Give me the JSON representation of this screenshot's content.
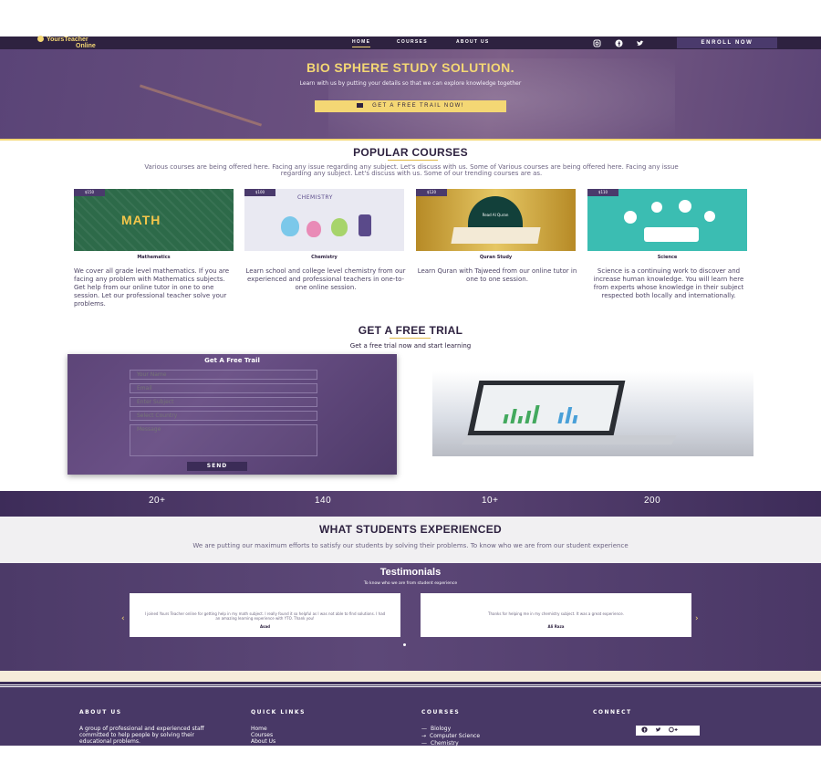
{
  "brand": {
    "line1": "YoursTeacher",
    "line2": "Online"
  },
  "nav": {
    "items": [
      "HOME",
      "COURSES",
      "ABOUT US"
    ],
    "enroll": "ENROLL NOW"
  },
  "social_icons": [
    "instagram-icon",
    "facebook-icon",
    "twitter-icon"
  ],
  "hero": {
    "title": "BIO SPHERE STUDY SOLUTION.",
    "subtitle": "Learn with us by putting your details so that we can explore knowledge together",
    "button": "GET A FREE TRAIL NOW!"
  },
  "popular": {
    "title": "POPULAR COURSES",
    "description": "Various courses are being offered here. Facing any issue regarding any subject. Let's discuss with us. Some of Various courses are being offered here. Facing any issue regarding any subject. Let's discuss with us. Some of our trending courses are as.",
    "courses": [
      {
        "price": "$150",
        "image_label": "MATH",
        "name": "Mathematics",
        "desc": "We cover all grade level mathematics. If you are facing any problem with Mathematics subjects. Get help from our online tutor in one to one session. Let our professional teacher solve your problems."
      },
      {
        "price": "$100",
        "image_label": "CHEMISTRY",
        "name": "Chemistry",
        "desc": "Learn school and college level chemistry from our experienced and professional teachers in one-to-one online session."
      },
      {
        "price": "$120",
        "image_label": "Read Al Quran",
        "name": "Quran Study",
        "desc": "Learn Quran with Tajweed from our online tutor in one to one session."
      },
      {
        "price": "$110",
        "image_label": "",
        "name": "Science",
        "desc": "Science is a continuing work to discover and increase human knowledge. You will learn here from experts whose knowledge in their subject respected both locally and internationally."
      }
    ]
  },
  "trial": {
    "title": "GET A FREE TRIAL",
    "subtitle": "Get a free trial now and start learning",
    "form_title": "Get A Free Trail",
    "fields": [
      "Your Name",
      "Email",
      "Enter Subject",
      "Select Country",
      "Message"
    ],
    "send": "SEND"
  },
  "stats": [
    "20+",
    "140",
    "10+",
    "200"
  ],
  "experience": {
    "title": "WHAT STUDENTS EXPERIENCED",
    "description": "We are putting our maximum efforts to satisfy our students by solving their problems. To know who we are from our student experience"
  },
  "testimonials": {
    "title": "Testimonials",
    "subtitle": "To know who we are from student experience",
    "prev": "‹",
    "next": "›",
    "items": [
      {
        "quote": "I joined Yours Teacher online for getting help in my math subject. I really found it so helpful as I was not able to find solutions. I had an amazing learning experience with YTO. Thank you!",
        "author": "Asad"
      },
      {
        "quote": "Thanks for helping me in my chemistry subject. It was a great experience.",
        "author": "Ali Raza"
      }
    ]
  },
  "footer": {
    "about_head": "ABOUT US",
    "about_text": "A group of professional and experienced staff committed to help people by solving their educational problems.",
    "links_head": "QUICK LINKS",
    "links": [
      "Home",
      "Courses",
      "About Us"
    ],
    "courses_head": "COURSES",
    "courses": [
      "Biology",
      "Computer Science",
      "Chemistry"
    ],
    "connect_head": "CONNECT",
    "connect_icons": [
      "facebook-icon",
      "twitter-icon",
      "google-plus-icon"
    ]
  },
  "colors": {
    "accent": "#f4d774",
    "brand_dark": "#2e2240",
    "brand_purple": "#4a3a6c",
    "footer_bg": "#483866"
  }
}
